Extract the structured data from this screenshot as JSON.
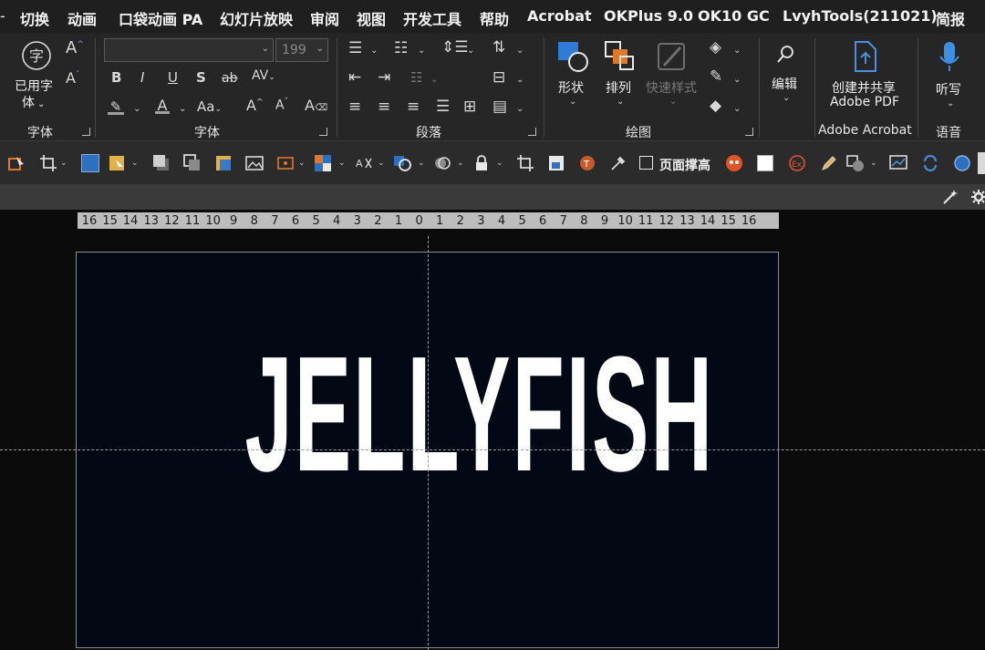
{
  "menu_tabs": [
    "切换",
    "动画",
    "口袋动画 PA",
    "幻灯片放映",
    "审阅",
    "视图",
    "开发工具",
    "帮助",
    "Acrobat",
    "OKPlus 9.0",
    "OK10 GC",
    "LvyhTools(211021)",
    "简报"
  ],
  "ribbon": {
    "font_group1": {
      "button_label_line1": "已用字",
      "button_label_line2": "体",
      "group_label": "字体"
    },
    "font_group2": {
      "font_name_value": "",
      "font_size_value": "199",
      "group_label": "字体"
    },
    "paragraph": {
      "group_label": "段落"
    },
    "drawing": {
      "shape_label": "形状",
      "arrange_label": "排列",
      "quick_styles_label": "快速样式",
      "group_label": "绘图"
    },
    "editing": {
      "label": "编辑"
    },
    "adobe": {
      "line1": "创建并共享",
      "line2": "Adobe PDF",
      "group_label": "Adobe Acrobat"
    },
    "voice": {
      "label": "听写",
      "group_label": "语音"
    }
  },
  "quickbar": {
    "page_height_label": "页面撑高"
  },
  "ruler_ticks": [
    "16",
    "15",
    "14",
    "13",
    "12",
    "11",
    "10",
    "9",
    "8",
    "7",
    "6",
    "5",
    "4",
    "3",
    "2",
    "1",
    "0",
    "1",
    "2",
    "3",
    "4",
    "5",
    "6",
    "7",
    "8",
    "9",
    "10",
    "11",
    "12",
    "13",
    "14",
    "15",
    "16"
  ],
  "slide": {
    "title": "JELLYFISH",
    "background": "#030814"
  },
  "colors": {
    "accent_blue": "#2f7bd6",
    "accent_orange": "#e0782a",
    "ribbon_bg": "#262626"
  }
}
